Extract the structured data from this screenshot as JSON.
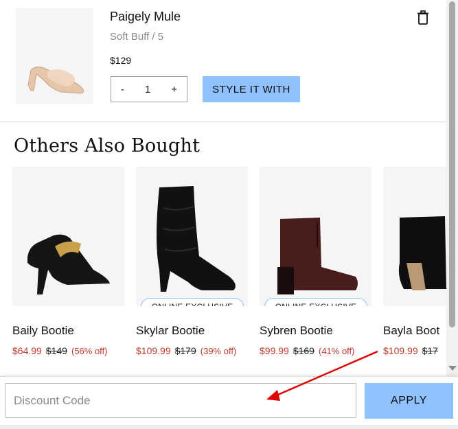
{
  "cart_item": {
    "title": "Paigely Mule",
    "variant": "Soft Buff / 5",
    "price": "$129",
    "quantity": "1",
    "qty_minus": "-",
    "qty_plus": "+",
    "style_button": "STYLE IT WITH",
    "delete_icon": "trash-icon"
  },
  "section": {
    "title": "Others Also Bought"
  },
  "products": [
    {
      "name": "Baily Bootie",
      "sale": "$64.99",
      "orig": "$149",
      "off": "(56% off)",
      "badge": ""
    },
    {
      "name": "Skylar Bootie",
      "sale": "$109.99",
      "orig": "$179",
      "off": "(39% off)",
      "badge": "ONLINE EXCLUSIVE"
    },
    {
      "name": "Sybren Bootie",
      "sale": "$99.99",
      "orig": "$169",
      "off": "(41% off)",
      "badge": "ONLINE EXCLUSIVE"
    },
    {
      "name": "Bayla Boot",
      "sale": "$109.99",
      "orig": "$17",
      "off": "",
      "badge": ""
    }
  ],
  "discount": {
    "placeholder": "Discount Code",
    "apply_label": "APPLY"
  },
  "colors": {
    "accent": "#8fc1ff",
    "sale_red": "#c0392b",
    "annotation_arrow": "#e00000"
  }
}
